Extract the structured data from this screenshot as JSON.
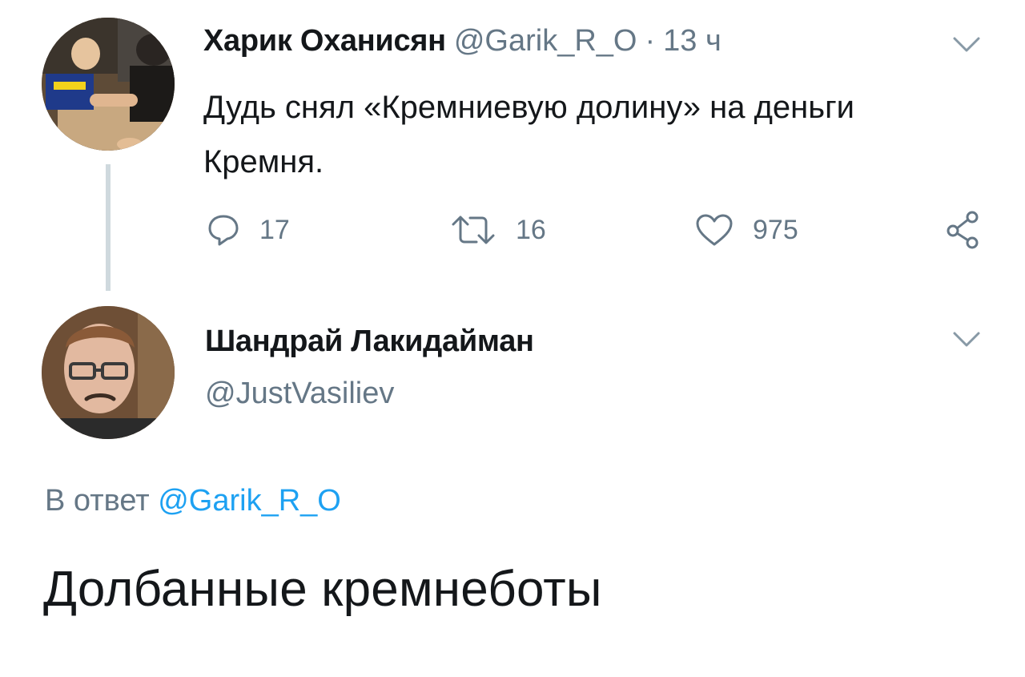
{
  "tweet1": {
    "author_name": "Харик Оханисян",
    "handle": "@Garik_R_O",
    "separator": "·",
    "time": "13 ч",
    "text": "Дудь снял «Кремниевую долину» на деньги Кремня.",
    "actions": {
      "replies": "17",
      "retweets": "16",
      "likes": "975"
    },
    "icons": {
      "reply": "reply-icon",
      "retweet": "retweet-icon",
      "like": "heart-icon",
      "share": "share-icon",
      "menu": "chevron-down-icon"
    }
  },
  "tweet2": {
    "author_name": "Шандрай Лакидайман",
    "handle": "@JustVasiliev",
    "reply_prefix": "В ответ",
    "reply_mention": "@Garik_R_O",
    "text": "Долбанные кремнеботы"
  },
  "colors": {
    "text_primary": "#14171a",
    "text_secondary": "#657786",
    "link": "#1da1f2",
    "thread_line": "#cfd9de"
  }
}
